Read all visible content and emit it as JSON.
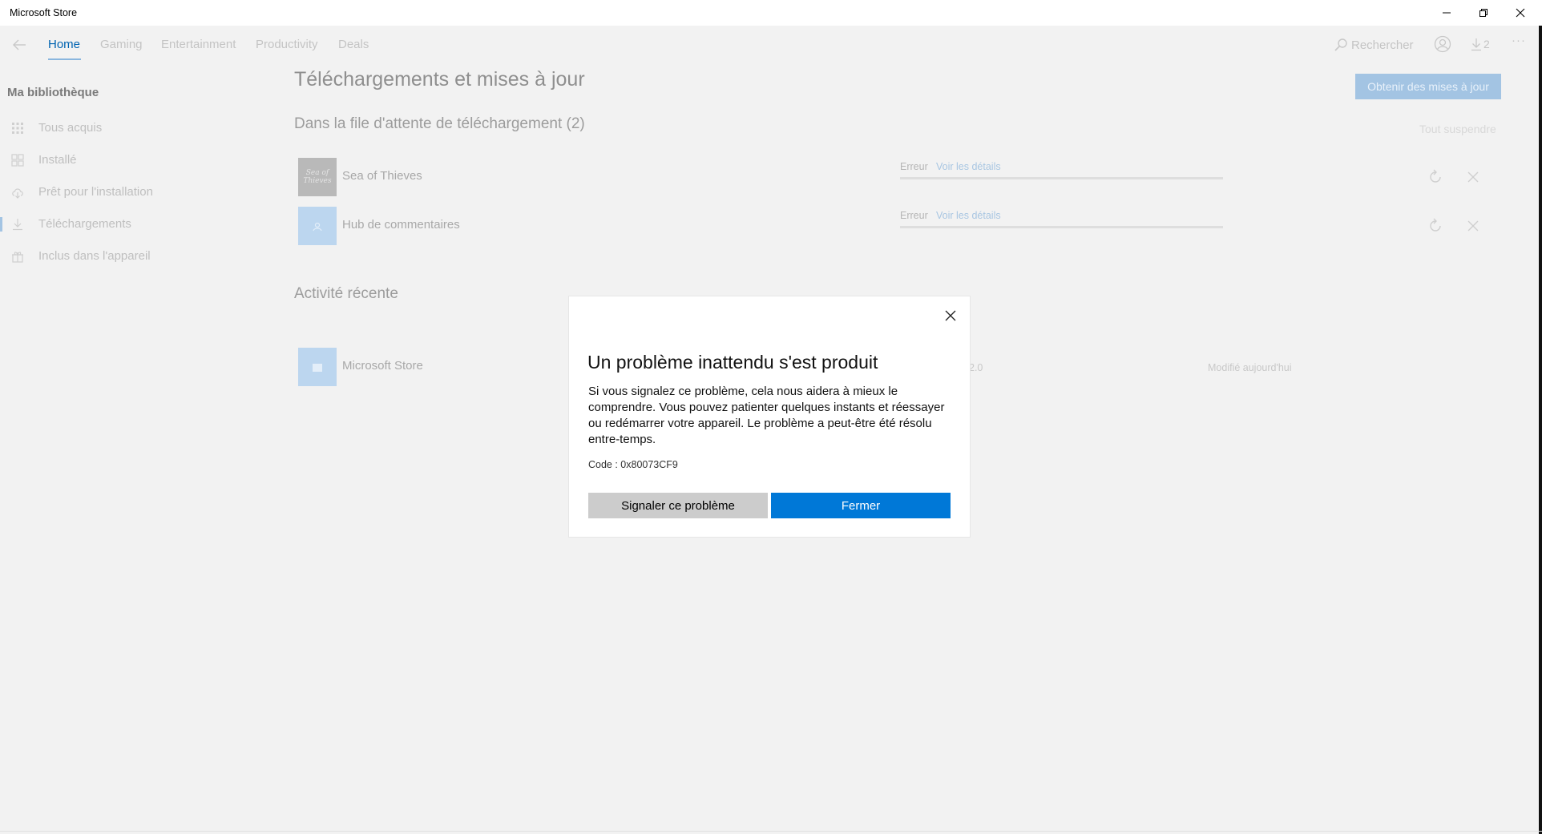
{
  "window": {
    "title": "Microsoft Store"
  },
  "nav": {
    "tabs": [
      {
        "label": "Home"
      },
      {
        "label": "Gaming"
      },
      {
        "label": "Entertainment"
      },
      {
        "label": "Productivity"
      },
      {
        "label": "Deals"
      }
    ],
    "search_label": "Rechercher",
    "downloads_count": "2",
    "more": "···"
  },
  "sidebar": {
    "title": "Ma bibliothèque",
    "items": [
      {
        "label": "Tous acquis",
        "icon": "grid-dots-icon"
      },
      {
        "label": "Installé",
        "icon": "grid-icon"
      },
      {
        "label": "Prêt pour l'installation",
        "icon": "cloud-download-icon"
      },
      {
        "label": "Téléchargements",
        "icon": "download-icon"
      },
      {
        "label": "Inclus dans l'appareil",
        "icon": "gift-icon"
      }
    ]
  },
  "main": {
    "title": "Téléchargements et mises à jour",
    "get_updates_label": "Obtenir des mises à jour",
    "queue_title": "Dans la file d'attente de téléchargement (2)",
    "pause_all_label": "Tout suspendre",
    "queue": [
      {
        "name": "Sea of Thieves",
        "status": "Erreur",
        "details_link": "Voir les détails",
        "thumb_text": "Sea of Thieves"
      },
      {
        "name": "Hub de commentaires",
        "status": "Erreur",
        "details_link": "Voir les détails"
      }
    ],
    "recent_title": "Activité récente",
    "recent": [
      {
        "name": "Microsoft Store",
        "version": "2.0",
        "date": "Modifié aujourd'hui"
      }
    ]
  },
  "dialog": {
    "title": "Un problème inattendu s'est produit",
    "body": "Si vous signalez ce problème, cela nous aidera à mieux le comprendre. Vous pouvez patienter quelques instants et réessayer ou redémarrer votre appareil. Le problème a peut-être été résolu entre-temps.",
    "code": "Code : 0x80073CF9",
    "report_label": "Signaler ce problème",
    "close_label": "Fermer"
  },
  "colors": {
    "accent": "#0078d7",
    "secondary_button": "#cccccc",
    "background": "#f2f2f2"
  }
}
